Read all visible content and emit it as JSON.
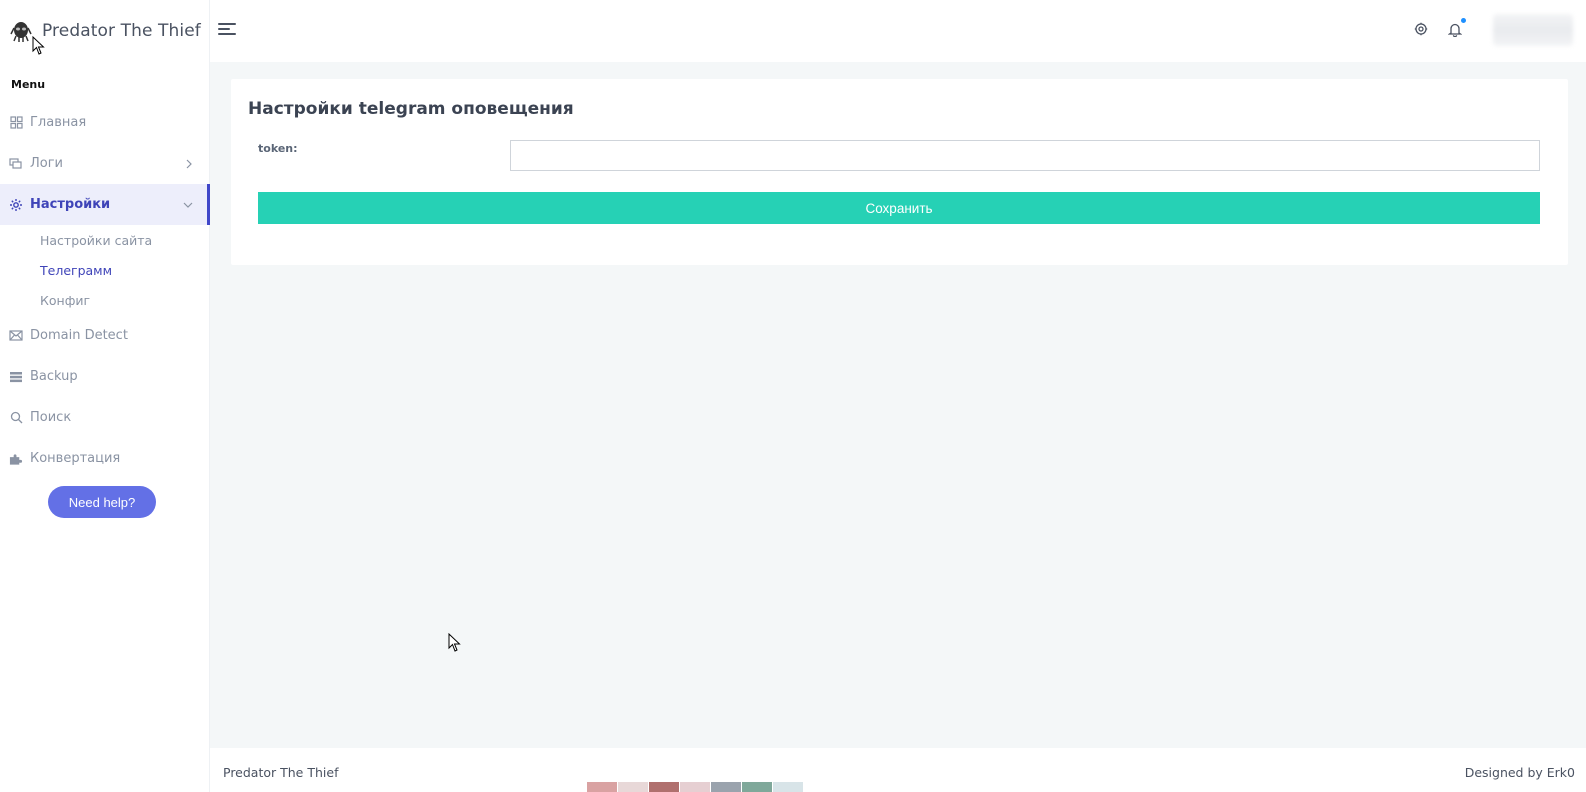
{
  "brand": {
    "name": "Predator The Thief"
  },
  "sidebar": {
    "menu_title": "Menu",
    "items": [
      {
        "label": "Главная",
        "icon": "grid-icon"
      },
      {
        "label": "Логи",
        "icon": "logs-icon"
      },
      {
        "label": "Настройки",
        "icon": "gear-icon"
      },
      {
        "label": "Domain Detect",
        "icon": "mail-icon"
      },
      {
        "label": "Backup",
        "icon": "database-icon"
      },
      {
        "label": "Поиск",
        "icon": "search-icon"
      },
      {
        "label": "Конвертация",
        "icon": "puzzle-icon"
      }
    ],
    "settings_sub": [
      {
        "label": "Настройки сайта"
      },
      {
        "label": "Телеграмм"
      },
      {
        "label": "Конфиг"
      }
    ],
    "help_label": "Need help?"
  },
  "topbar": {
    "icons": [
      "hamburger-icon",
      "gear-icon",
      "bell-icon"
    ]
  },
  "main": {
    "title": "Настройки telegram оповещения",
    "token_label": "token:",
    "token_value": "",
    "save_label": "Сохранить"
  },
  "footer": {
    "left": "Predator The Thief",
    "right": "Designed by Erk0"
  },
  "colors": {
    "accent": "#4047c9",
    "save_button": "#26d1b5",
    "help_button": "#6370e6",
    "background": "#f4f7f8"
  }
}
